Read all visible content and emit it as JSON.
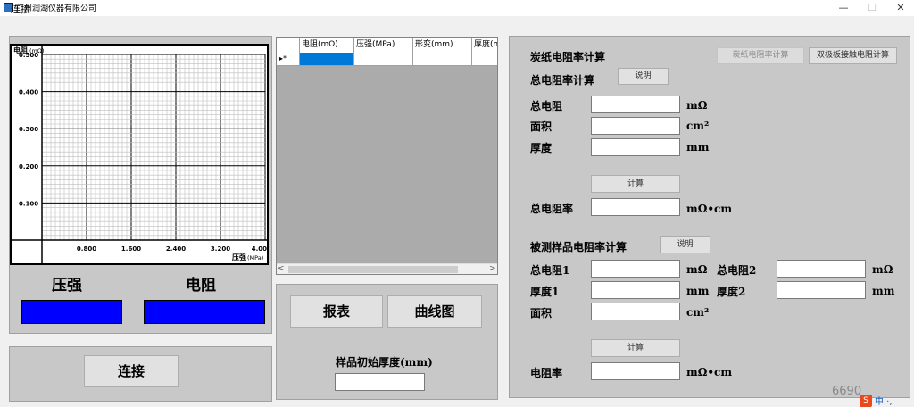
{
  "window": {
    "title": "广州润湖仪器有限公司",
    "min": "—",
    "max": "☐",
    "close": "✕"
  },
  "menu": {
    "connect": "连接"
  },
  "chart_data": {
    "type": "line",
    "title": "",
    "ylabel": "电阻",
    "yunit": "(mΩ)",
    "xlabel": "压强",
    "xunit": "(MPa)",
    "xlim": [
      0,
      4.0
    ],
    "ylim": [
      0,
      0.5
    ],
    "yticks": [
      "0.500",
      "0.400",
      "0.300",
      "0.200",
      "0.100"
    ],
    "xticks": [
      "0.800",
      "1.600",
      "2.400",
      "3.200",
      "4.00"
    ],
    "series": [],
    "grid": true
  },
  "left": {
    "pressure_title": "压强",
    "resistance_title": "电阻",
    "connect_button": "连接",
    "display_color": "#0000ff"
  },
  "grid": {
    "columns": [
      "电阻(mΩ)",
      "压强(MPa)",
      "形变(mm)",
      "厚度(m"
    ],
    "new_row_marker": "▸*",
    "scroll_left": "<",
    "scroll_right": ">"
  },
  "middle": {
    "report_button": "报表",
    "curve_button": "曲线图",
    "thickness_label": "样品初始厚度(mm)"
  },
  "right": {
    "title": "炭纸电阻率计算",
    "carbon_resist_button": "炭纸电阻率计算",
    "bipolar_button": "双极板接触电阻计算",
    "total_section_title": "总电阻率计算",
    "total_help": "说明",
    "total_resistance_label": "总电阻",
    "total_resistance_unit": "mΩ",
    "area_label": "面积",
    "area_unit": "cm²",
    "thickness_label": "厚度",
    "thickness_unit": "mm",
    "calc_button_1": "计算",
    "total_resistivity_label": "总电阻率",
    "total_resistivity_unit": "mΩ•cm",
    "sample_section_title": "被测样品电阻率计算",
    "sample_help": "说明",
    "r1_label": "总电阻1",
    "r1_unit": "mΩ",
    "r2_label": "总电阻2",
    "r2_unit": "mΩ",
    "t1_label": "厚度1",
    "t1_unit": "mm",
    "t2_label": "厚度2",
    "t2_unit": "mm",
    "sample_area_label": "面积",
    "sample_area_unit": "cm²",
    "calc_button_2": "计算",
    "resistivity_label": "电阻率",
    "resistivity_unit": "mΩ•cm"
  },
  "overlay": {
    "watermark": "6690",
    "ime_logo": "S",
    "ime_mode": "中 ·,"
  }
}
